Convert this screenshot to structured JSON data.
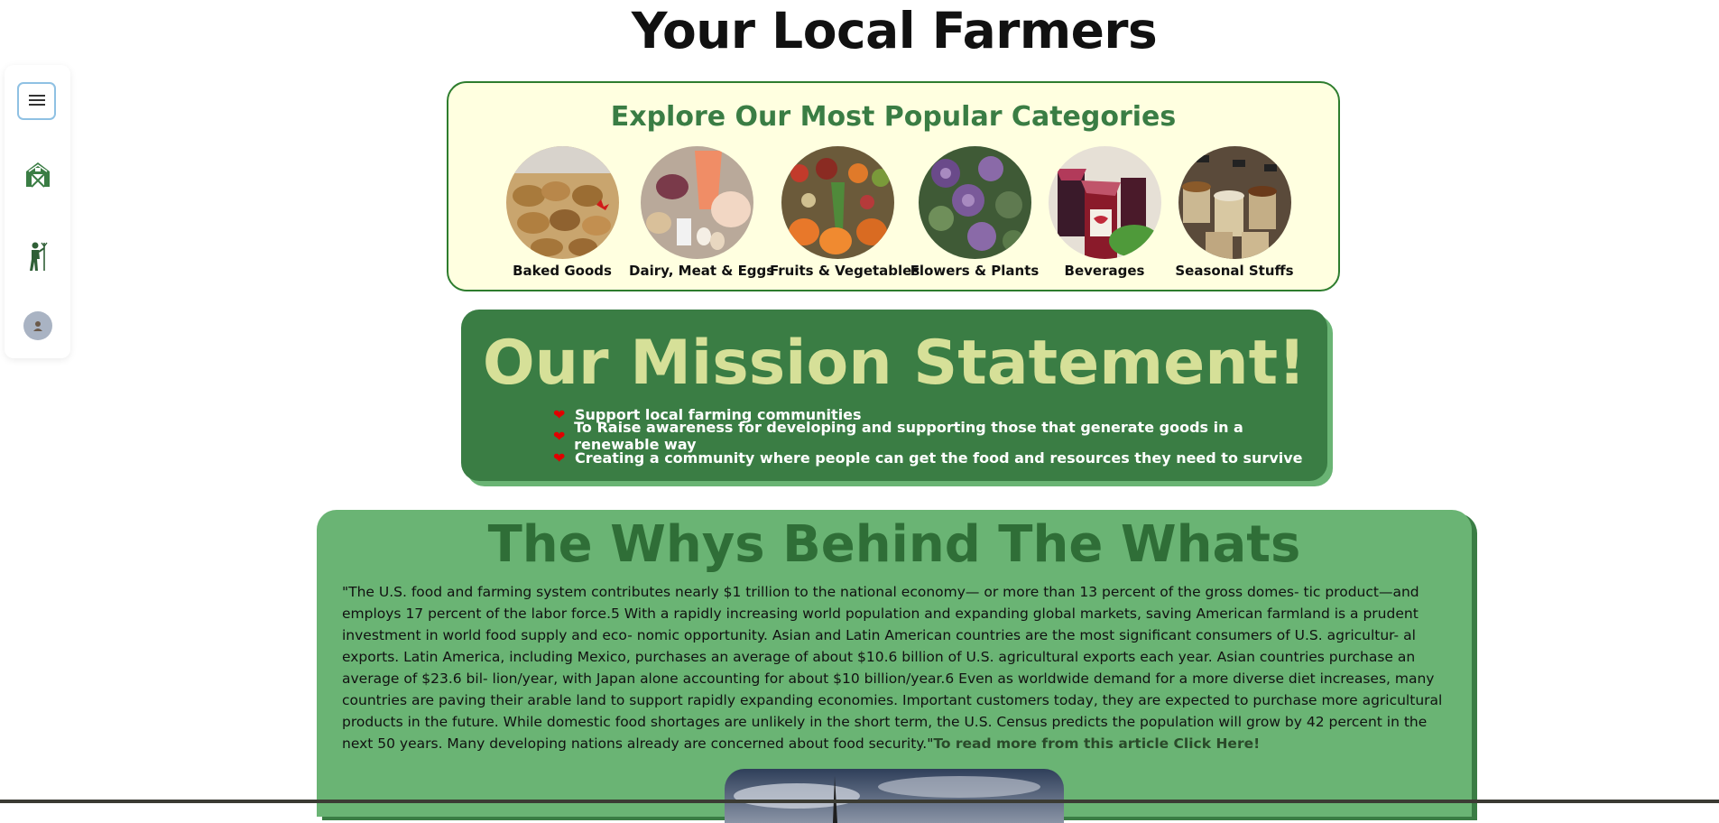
{
  "page": {
    "title": "Your Local Farmers"
  },
  "sidebar": {
    "icons": [
      "menu-icon",
      "barn-icon",
      "farmer-icon",
      "profile-icon"
    ]
  },
  "categories": {
    "heading": "Explore Our Most Popular Categories",
    "items": [
      {
        "label": "Baked Goods",
        "icon": "baked-goods-image"
      },
      {
        "label": "Dairy, Meat & Eggs",
        "icon": "dairy-meat-eggs-image"
      },
      {
        "label": "Fruits & Vegetables",
        "icon": "fruits-vegetables-image"
      },
      {
        "label": "Flowers & Plants",
        "icon": "flowers-plants-image"
      },
      {
        "label": "Beverages",
        "icon": "beverages-image"
      },
      {
        "label": "Seasonal Stuffs",
        "icon": "seasonal-stuffs-image"
      }
    ]
  },
  "mission": {
    "title": "Our Mission Statement!",
    "points": [
      "Support local farming communities",
      "To Raise awareness for developing and supporting those that generate goods in a renewable way",
      "Creating a community where people can get the food and resources they need to survive"
    ]
  },
  "whys": {
    "title": "The Whys Behind The Whats",
    "quote": "\"The U.S. food and farming system contributes nearly $1 trillion to the national economy— or more than 13 percent of the gross domes- tic product—and employs 17 percent of the labor force.5 With a rapidly increasing world population and expanding global markets, saving American farmland is a prudent investment in world food supply and eco- nomic opportunity. Asian and Latin American countries are the most significant consumers of U.S. agricultur- al exports. Latin America, including Mexico, purchases an average of about $10.6 billion of U.S. agricultural exports each year. Asian countries purchase an average of $23.6 bil- lion/year, with Japan alone accounting for about $10 billion/year.6 Even as worldwide demand for a more diverse diet increases, many countries are paving their arable land to support rapidly expanding economies. Important customers today, they are expected to purchase more agricultural products in the future. While domestic food shortages are unlikely in the short term, the U.S. Census predicts the population will grow by 42 percent in the next 50 years. Many developing nations already are concerned about food security.\"",
    "link_text": "To read more from this article Click Here!"
  },
  "colors": {
    "brand_green": "#3a7d44",
    "light_green": "#6ab474",
    "cream": "#ffffe0",
    "mission_title": "#d6e098",
    "heart": "#e00000"
  }
}
